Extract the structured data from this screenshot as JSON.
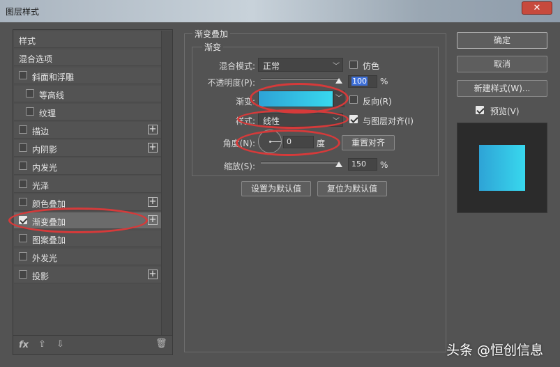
{
  "window": {
    "title": "图层样式",
    "close": "✕"
  },
  "left_list": {
    "header": "样式",
    "items": [
      {
        "label": "混合选项",
        "check": false,
        "checked": false,
        "plus": false,
        "indent": 0
      },
      {
        "label": "斜面和浮雕",
        "check": true,
        "checked": false,
        "plus": false,
        "indent": 0
      },
      {
        "label": "等高线",
        "check": true,
        "checked": false,
        "plus": false,
        "indent": 1
      },
      {
        "label": "纹理",
        "check": true,
        "checked": false,
        "plus": false,
        "indent": 1
      },
      {
        "label": "描边",
        "check": true,
        "checked": false,
        "plus": true,
        "indent": 0
      },
      {
        "label": "内阴影",
        "check": true,
        "checked": false,
        "plus": true,
        "indent": 0
      },
      {
        "label": "内发光",
        "check": true,
        "checked": false,
        "plus": false,
        "indent": 0
      },
      {
        "label": "光泽",
        "check": true,
        "checked": false,
        "plus": false,
        "indent": 0
      },
      {
        "label": "颜色叠加",
        "check": true,
        "checked": false,
        "plus": true,
        "indent": 0
      },
      {
        "label": "渐变叠加",
        "check": true,
        "checked": true,
        "plus": true,
        "indent": 0,
        "selected": true
      },
      {
        "label": "图案叠加",
        "check": true,
        "checked": false,
        "plus": false,
        "indent": 0
      },
      {
        "label": "外发光",
        "check": true,
        "checked": false,
        "plus": false,
        "indent": 0
      },
      {
        "label": "投影",
        "check": true,
        "checked": false,
        "plus": true,
        "indent": 0
      }
    ],
    "footer": {
      "fx": "fx",
      "up": "⇧",
      "down": "⇩",
      "trash": "🗑"
    },
    "plus_symbol": "+"
  },
  "gradient_overlay": {
    "section_title": "渐变叠加",
    "sub_title": "渐变",
    "blend_mode_label": "混合模式:",
    "blend_mode_value": "正常",
    "dither_label": "仿色",
    "opacity_label": "不透明度(P):",
    "opacity_value": "100",
    "opacity_percent": 100,
    "percent_sign": "%",
    "gradient_label": "渐变:",
    "reverse_label": "反向(R)",
    "style_label": "样式:",
    "style_value": "线性",
    "align_label": "与图层对齐(I)",
    "angle_label": "角度(N):",
    "angle_value": "0",
    "angle_unit": "度",
    "reset_align_label": "重置对齐",
    "scale_label": "缩放(S):",
    "scale_value": "150",
    "scale_percent": 150,
    "make_default_label": "设置为默认值",
    "reset_default_label": "复位为默认值"
  },
  "buttons": {
    "ok": "确定",
    "cancel": "取消",
    "new_style": "新建样式(W)...",
    "preview_label": "预览(V)"
  },
  "colors": {
    "gradient_start": "#2ea3d6",
    "gradient_end": "#38d8ee",
    "highlight_ring": "#d63a3a",
    "panel_bg": "#535353"
  },
  "watermark": "头条 @恒创信息"
}
